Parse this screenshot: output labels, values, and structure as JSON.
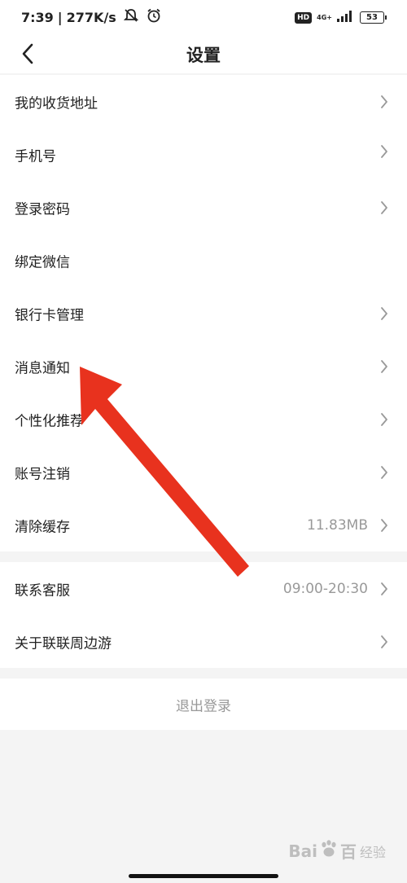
{
  "status_bar": {
    "time": "7:39",
    "speed": "277K/s",
    "hd": "HD",
    "network": "4G+",
    "battery": "53"
  },
  "nav": {
    "title": "设置"
  },
  "settings_group_1": [
    {
      "label": "我的收货地址",
      "value": "",
      "chevron": true
    },
    {
      "label": "手机号",
      "value": "",
      "chevron": true
    },
    {
      "label": "登录密码",
      "value": "",
      "chevron": true
    },
    {
      "label": "绑定微信",
      "value": "",
      "chevron": false
    },
    {
      "label": "银行卡管理",
      "value": "",
      "chevron": true
    },
    {
      "label": "消息通知",
      "value": "",
      "chevron": true
    },
    {
      "label": "个性化推荐",
      "value": "",
      "chevron": true
    },
    {
      "label": "账号注销",
      "value": "",
      "chevron": true
    },
    {
      "label": "清除缓存",
      "value": "11.83MB",
      "chevron": true
    }
  ],
  "settings_group_2": [
    {
      "label": "联系客服",
      "value": "09:00-20:30",
      "chevron": true
    },
    {
      "label": "关于联联周边游",
      "value": "",
      "chevron": true
    }
  ],
  "logout_label": "退出登录",
  "watermark": {
    "brand": "Bai",
    "brand_end": "百",
    "sub": "经验"
  },
  "colors": {
    "annotation_arrow": "#e8321e",
    "background": "#f4f4f4",
    "card": "#ffffff",
    "secondary_text": "#999999"
  }
}
